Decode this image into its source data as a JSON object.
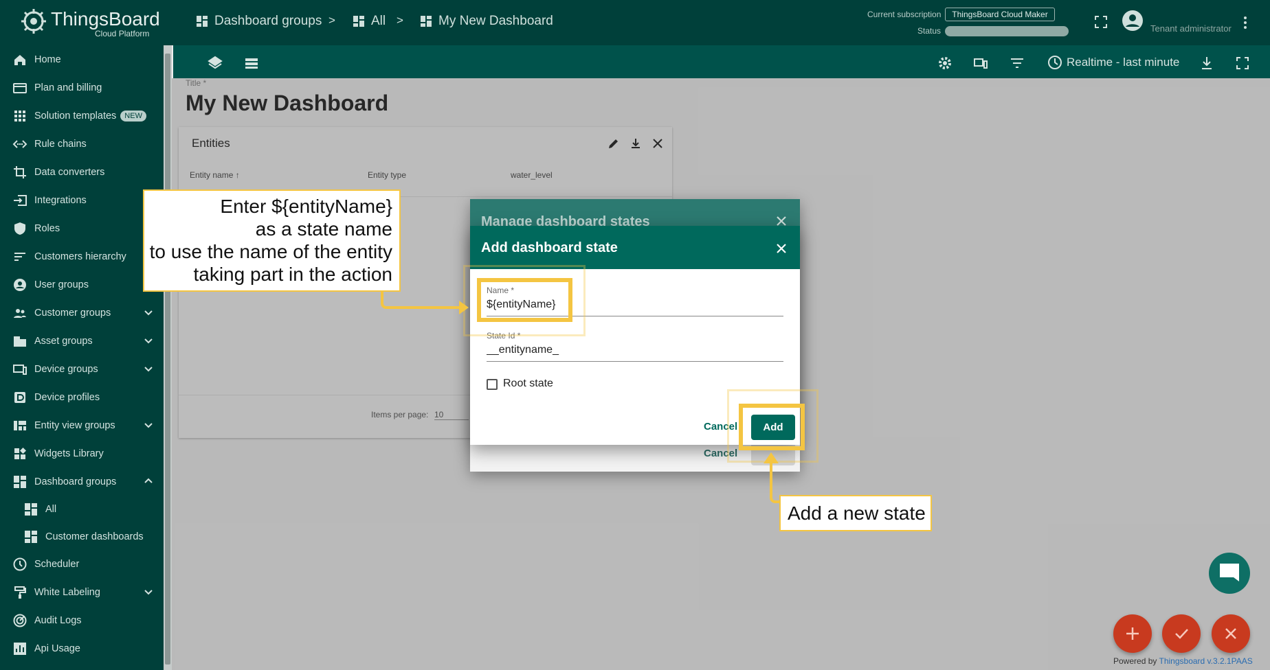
{
  "app": {
    "logo_text": "ThingsBoard",
    "logo_sub": "Cloud Platform"
  },
  "breadcrumb": [
    "Dashboard groups",
    "All",
    "My New Dashboard"
  ],
  "breadcrumb_sep": ">",
  "subscription": {
    "label": "Current subscription",
    "plan": "ThingsBoard Cloud Maker",
    "status_label": "Status"
  },
  "user": {
    "role": "Tenant administrator"
  },
  "toolbar": {
    "timewindow": "Realtime - last minute"
  },
  "sidebar": {
    "items": [
      {
        "label": "Home",
        "icon": "home-icon"
      },
      {
        "label": "Plan and billing",
        "icon": "credit-card-icon"
      },
      {
        "label": "Solution templates",
        "icon": "apps-icon",
        "badge": "NEW"
      },
      {
        "label": "Rule chains",
        "icon": "settings-ethernet-icon"
      },
      {
        "label": "Data converters",
        "icon": "transform-icon"
      },
      {
        "label": "Integrations",
        "icon": "input-icon"
      },
      {
        "label": "Roles",
        "icon": "shield-icon"
      },
      {
        "label": "Customers hierarchy",
        "icon": "sort-icon"
      },
      {
        "label": "User groups",
        "icon": "account-circle-icon"
      },
      {
        "label": "Customer groups",
        "icon": "supervisor-icon",
        "expand": "down"
      },
      {
        "label": "Asset groups",
        "icon": "domain-icon",
        "expand": "down"
      },
      {
        "label": "Device groups",
        "icon": "devices-icon",
        "expand": "down"
      },
      {
        "label": "Device profiles",
        "icon": "device-profile-icon"
      },
      {
        "label": "Entity view groups",
        "icon": "view-quilt-icon",
        "expand": "down"
      },
      {
        "label": "Widgets Library",
        "icon": "widgets-icon"
      },
      {
        "label": "Dashboard groups",
        "icon": "dashboard-icon",
        "expand": "up"
      },
      {
        "label": "All",
        "icon": "dashboard-icon",
        "sub": true
      },
      {
        "label": "Customer dashboards",
        "icon": "dashboard-icon",
        "sub": true
      },
      {
        "label": "Scheduler",
        "icon": "schedule-icon"
      },
      {
        "label": "White Labeling",
        "icon": "format-paint-icon",
        "expand": "down"
      },
      {
        "label": "Audit Logs",
        "icon": "track-changes-icon"
      },
      {
        "label": "Api Usage",
        "icon": "insert-chart-icon"
      }
    ]
  },
  "dashboard": {
    "title_label": "Title *",
    "title": "My New Dashboard"
  },
  "widget": {
    "title": "Entities",
    "columns": [
      "Entity name",
      "Entity type",
      "water_level"
    ],
    "items_per_page_label": "Items per page:",
    "items_per_page": "10"
  },
  "manage_dialog": {
    "title": "Manage dashboard states",
    "cancel": "Cancel"
  },
  "add_dialog": {
    "title": "Add dashboard state",
    "name_label": "Name *",
    "name_value": "${entityName}",
    "state_id_label": "State Id *",
    "state_id_value": "__entityname_",
    "root_state_label": "Root state",
    "cancel": "Cancel",
    "add": "Add"
  },
  "callouts": {
    "name_hint": [
      "Enter ${entityName}",
      "as a state name",
      "to use the name of the entity",
      "taking part in the action"
    ],
    "add_hint": "Add a new state"
  },
  "footer": {
    "powered_by": "Powered by",
    "brand": "Thingsboard v.3.2.1PAAS"
  },
  "colors": {
    "header": "#00403a",
    "primary": "#00695c",
    "accent_highlight": "#f4c542",
    "fab": "#c83a1f"
  }
}
